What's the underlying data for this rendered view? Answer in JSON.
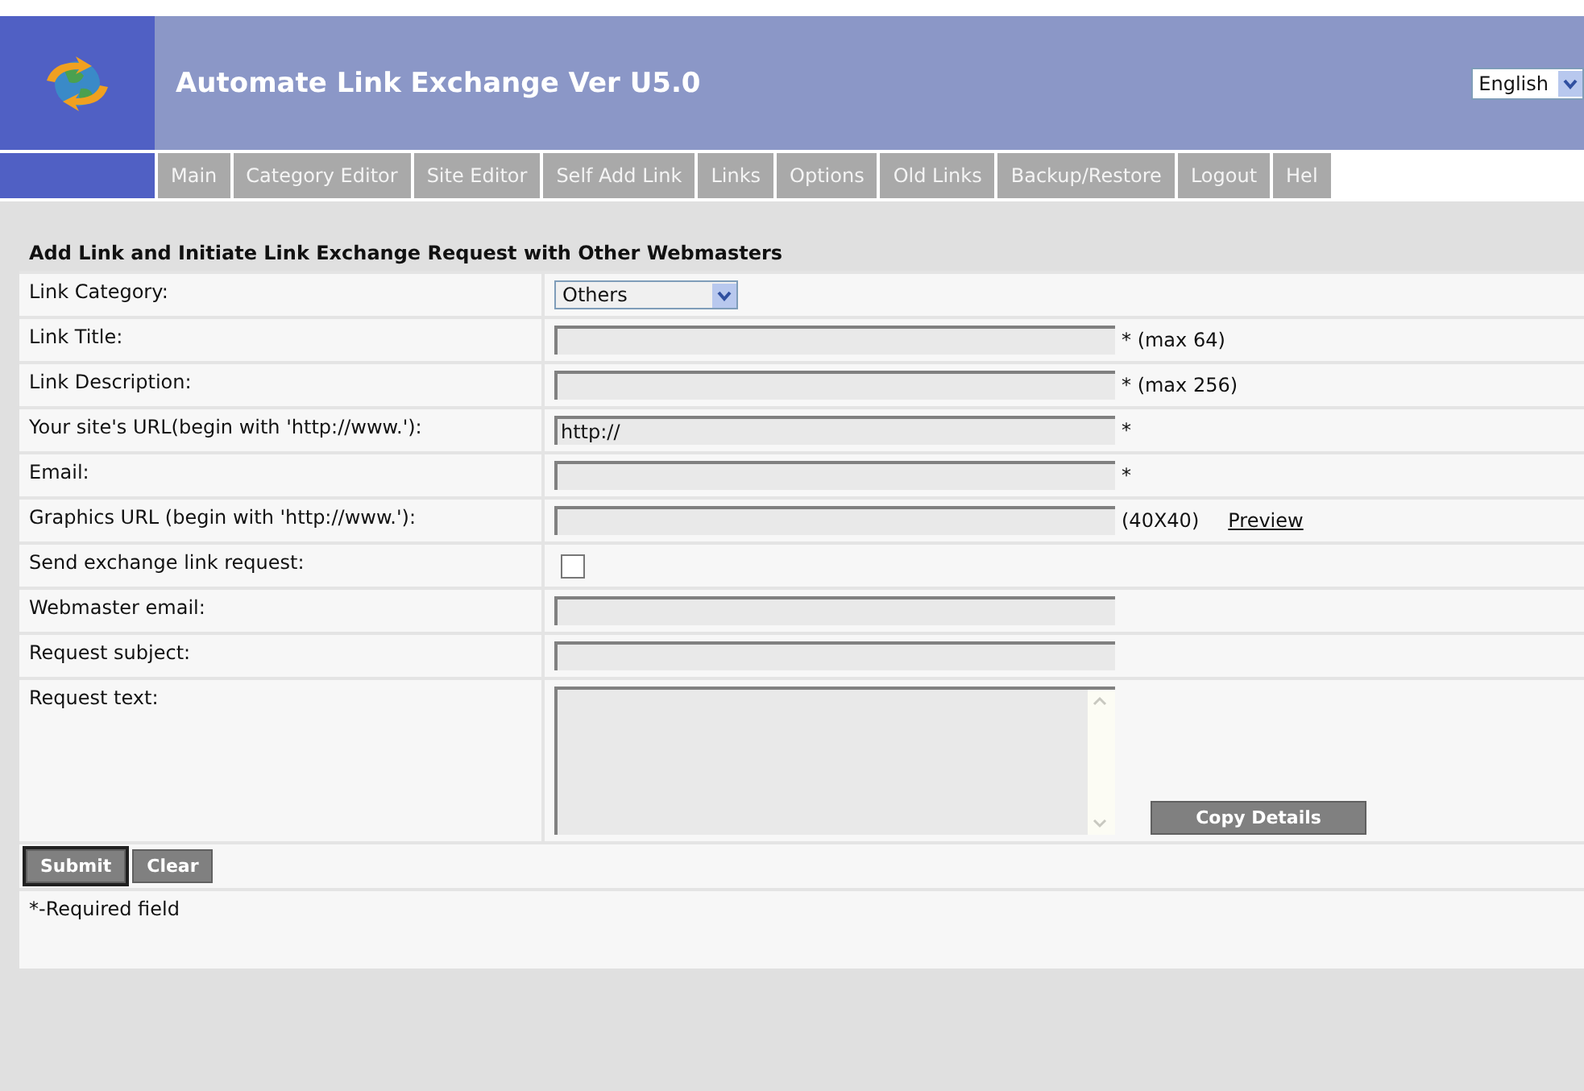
{
  "header": {
    "title": "Automate Link Exchange Ver U5.0",
    "language": "English"
  },
  "nav": [
    "Main",
    "Category Editor",
    "Site Editor",
    "Self Add Link",
    "Links",
    "Options",
    "Old Links",
    "Backup/Restore",
    "Logout",
    "Hel"
  ],
  "form": {
    "heading": "Add Link and Initiate Link Exchange Request with Other Webmasters",
    "rows": [
      {
        "label": "Link Category:",
        "kind": "select",
        "value": "Others"
      },
      {
        "label": "Link Title:",
        "kind": "text",
        "note": "* (max 64)"
      },
      {
        "label": "Link Description:",
        "kind": "text",
        "note": "* (max 256)"
      },
      {
        "label": "Your site's URL(begin with 'http://www.'):",
        "kind": "text",
        "value": "http://",
        "note": "*"
      },
      {
        "label": "Email:",
        "kind": "text",
        "note": "*"
      },
      {
        "label": "Graphics URL (begin with 'http://www.'):",
        "kind": "text",
        "note": "(40X40)",
        "link": "Preview"
      },
      {
        "label": "Send exchange link request:",
        "kind": "checkbox",
        "checked": false
      },
      {
        "label": "Webmaster email:",
        "kind": "text"
      },
      {
        "label": "Request subject:",
        "kind": "text"
      },
      {
        "label": "Request text:",
        "kind": "textarea",
        "button": "Copy Details"
      }
    ],
    "buttons": [
      "Submit",
      "Clear"
    ],
    "footnote": "*-Required field"
  }
}
